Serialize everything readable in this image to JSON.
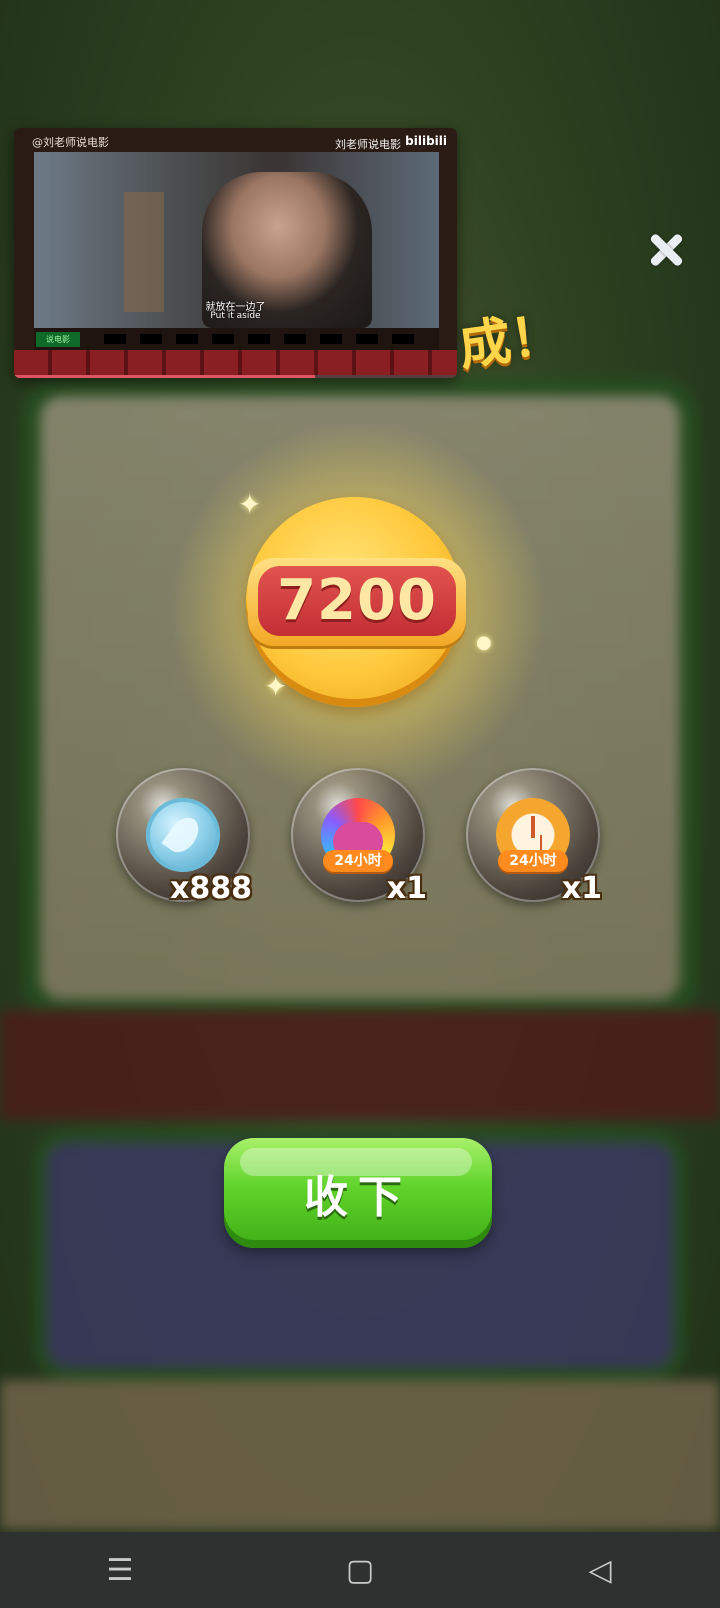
{
  "video": {
    "watermark_left": "@刘老师说电影",
    "watermark_right": "刘老师说电影",
    "logo": "bilibili",
    "subtitle_zh": "就放在一边了",
    "subtitle_en": "Put it aside",
    "badge": "说电影",
    "progress": 0.68
  },
  "title_tail": "成！",
  "coin_value": "7200",
  "rewards": [
    {
      "icon": "leaf-token-icon",
      "qty": "x888"
    },
    {
      "icon": "rainbow-owl-icon",
      "tag": "24小时",
      "qty": "x1"
    },
    {
      "icon": "clock-boost-icon",
      "tag": "24小时",
      "qty": "x1"
    }
  ],
  "collect_label": "收下",
  "nav": {
    "menu": "☰",
    "home": "▢",
    "back": "◁"
  }
}
